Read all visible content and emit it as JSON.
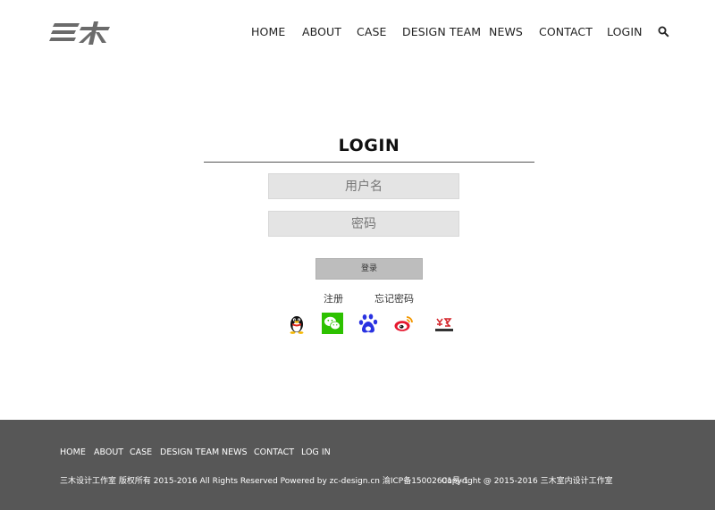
{
  "header": {
    "nav": [
      "HOME",
      "ABOUT",
      "CASE",
      "DESIGN TEAM",
      "NEWS",
      "CONTACT",
      "LOGIN"
    ],
    "search_icon": "search-icon"
  },
  "login": {
    "title": "LOGIN",
    "username_placeholder": "用户名",
    "password_placeholder": "密码",
    "submit_label": "登录",
    "register_label": "注册",
    "forgot_label": "忘记密码",
    "social_icons": [
      "qq-icon",
      "wechat-icon",
      "baidu-icon",
      "weibo-icon",
      "netease-icon"
    ]
  },
  "footer": {
    "nav": [
      "HOME",
      "ABOUT",
      "CASE",
      "DESIGN TEAM",
      "NEWS",
      "CONTACT",
      "LOG IN"
    ],
    "copyright_left": "三木设计工作室 版权所有 2015-2016 All Rights Reserved Powered by zc-design.cn 渝ICP备15002601号-1",
    "copyright_right": "Copyright @ 2015-2016 三木室内设计工作室"
  },
  "colors": {
    "footer_bg": "#575757",
    "field_bg": "#e4e4e4",
    "button_bg": "#bdbdbd",
    "wechat_green": "#2dc100"
  }
}
